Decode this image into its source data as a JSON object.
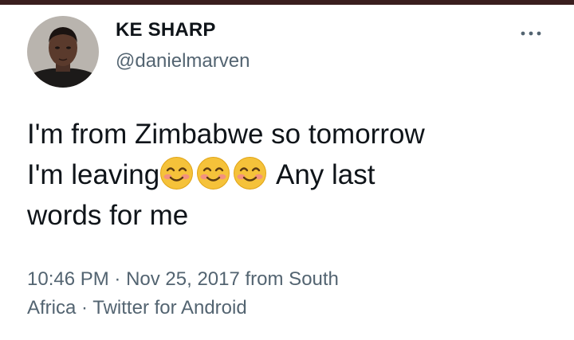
{
  "tweet": {
    "author": {
      "display_name": "KE SHARP",
      "handle": "@danielmarven"
    },
    "text": {
      "line1": "I'm from Zimbabwe so tomorrow",
      "line2_prefix": "I'm leaving",
      "line2_suffix": " Any last",
      "line3": "words for me"
    },
    "emojis": [
      "smiling-face-with-smiling-eyes-icon",
      "smiling-face-with-smiling-eyes-icon",
      "smiling-face-with-smiling-eyes-icon"
    ],
    "meta": {
      "time": "10:46 PM",
      "separator1": " · ",
      "date": "Nov 25, 2017",
      "from_label": " from South",
      "location_rest": "Africa",
      "separator2": " · ",
      "source": "Twitter for Android"
    },
    "more_icon": "more-horizontal-icon"
  },
  "colors": {
    "text_primary": "#0f1419",
    "text_secondary": "#536471",
    "top_strip": "#3a1e1e",
    "emoji_face": "#f5c23a",
    "emoji_blush": "#f28a8a"
  }
}
